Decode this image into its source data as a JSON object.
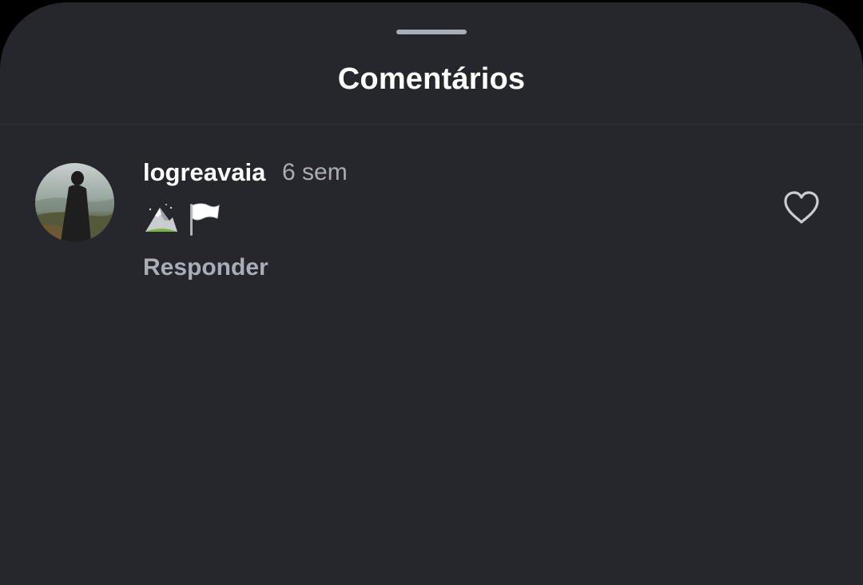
{
  "sheet": {
    "title": "Comentários"
  },
  "comments": [
    {
      "username": "logreavaia",
      "time_ago": "6 sem",
      "body_icons": [
        "snow-capped-mountain-icon",
        "white-flag-icon"
      ],
      "reply_label": "Responder",
      "liked": false
    }
  ],
  "colors": {
    "sheet_background": "#25272c",
    "primary_text": "#ffffff",
    "secondary_text": "#a9adb5"
  }
}
